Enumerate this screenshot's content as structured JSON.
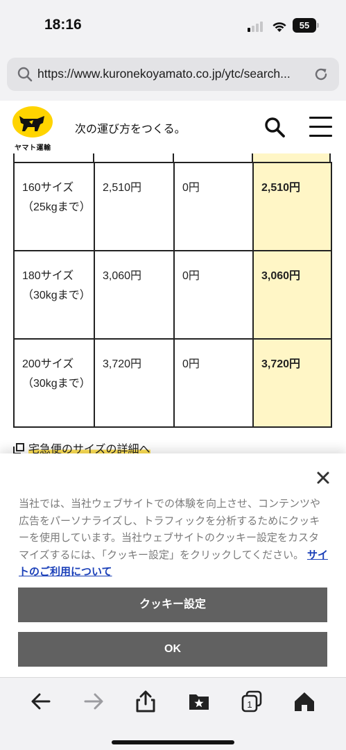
{
  "status_bar": {
    "time": "18:16",
    "battery": "55",
    "icons": [
      "signal-icon",
      "wifi-icon",
      "battery-icon"
    ]
  },
  "address_bar": {
    "url": "https://www.kuronekoyamato.co.jp/ytc/search...",
    "icons": [
      "search-icon",
      "reload-icon"
    ]
  },
  "header": {
    "logo_text": "ヤマト運輸",
    "tagline": "次の運び方をつくる。",
    "icons": [
      "search-icon",
      "hamburger-menu-icon"
    ],
    "logo_color": "#ffd400"
  },
  "rate_table": {
    "highlight_color": "#fff6c6",
    "rows": [
      {
        "size": "160サイズ（25kgまで）",
        "fare": "2,510円",
        "discount": "0円",
        "total": "2,510円"
      },
      {
        "size": "180サイズ（30kgまで）",
        "fare": "3,060円",
        "discount": "0円",
        "total": "3,060円"
      },
      {
        "size": "200サイズ（30kgまで）",
        "fare": "3,720円",
        "discount": "0円",
        "total": "3,720円"
      }
    ]
  },
  "links": {
    "size_detail": "宅急便のサイズの詳細へ"
  },
  "cookie_banner": {
    "message": "当社では、当社ウェブサイトでの体験を向上させ、コンテンツや広告をパーソナライズし、トラフィックを分析するためにクッキーを使用しています。当社ウェブサイトのクッキー設定をカスタマイズするには、「クッキー設定」をクリックしてください。",
    "link": "サイトのご利用について",
    "settings_button": "クッキー設定",
    "ok_button": "OK",
    "link_color": "#1a3fb8",
    "button_color": "#616161"
  },
  "toolbar": {
    "icons": [
      "back-icon",
      "forward-icon",
      "share-icon",
      "bookmarks-icon",
      "tabs-icon",
      "home-icon"
    ],
    "tab_count": "1"
  }
}
